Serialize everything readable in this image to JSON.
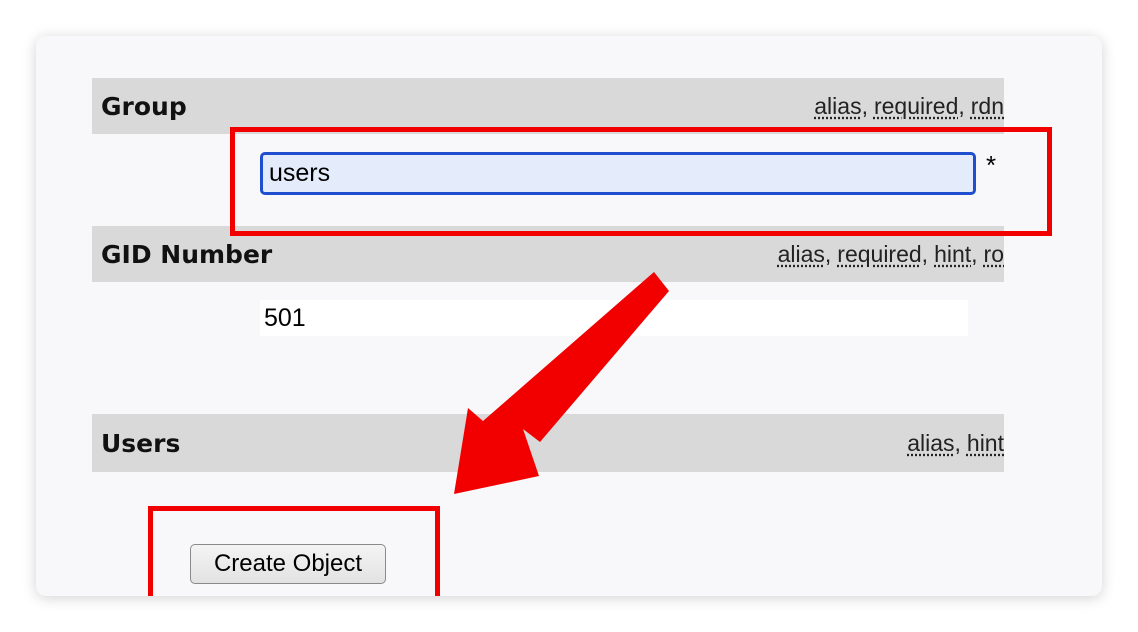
{
  "form": {
    "group": {
      "label": "Group",
      "flags": [
        "alias",
        "required",
        "rdn"
      ],
      "value": "users",
      "required_marker": "*"
    },
    "gid_number": {
      "label": "GID Number",
      "flags": [
        "alias",
        "required",
        "hint",
        "ro"
      ],
      "value": "501"
    },
    "users": {
      "label": "Users",
      "flags": [
        "alias",
        "hint"
      ]
    },
    "create_button_label": "Create Object"
  },
  "annotations": {
    "highlight_color": "#f20000",
    "arrow_color": "#f20000"
  }
}
